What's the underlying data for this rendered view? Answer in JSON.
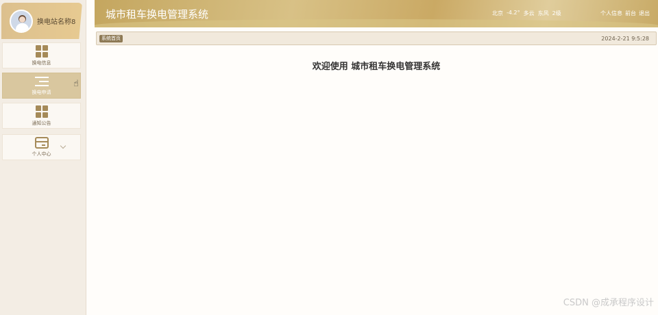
{
  "sidebar": {
    "profile_name": "换电站名称8",
    "items": [
      {
        "label": "换电信息"
      },
      {
        "label": "换电申请"
      },
      {
        "label": "通知公告"
      },
      {
        "label": "个人中心"
      }
    ]
  },
  "header": {
    "title": "城市租车换电管理系统",
    "weather": {
      "city": "北京",
      "temp": "-4.2°",
      "condition": "多云",
      "wind": "东风",
      "level": "2级"
    },
    "links": {
      "profile": "个人信息",
      "frontend": "前台",
      "logout": "退出"
    }
  },
  "breadcrumb": {
    "tag": "系统首页",
    "datetime": "2024-2-21 9:5:28"
  },
  "main": {
    "welcome": "欢迎使用 城市租车换电管理系统"
  },
  "watermark": "CSDN @成承程序设计",
  "colors": {
    "accent": "#c4a65f",
    "active_menu": "#d9c79f",
    "sidebar_bg": "#f3ede4"
  }
}
